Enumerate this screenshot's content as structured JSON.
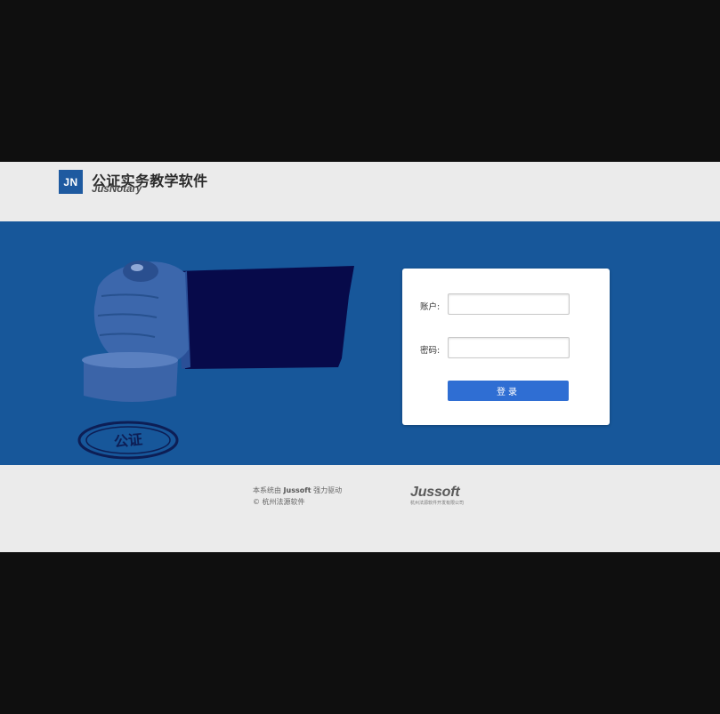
{
  "header": {
    "logo_mark": "JN",
    "title": "公证实务教学软件",
    "subtitle": "JusNotary"
  },
  "banner": {
    "stamp_text": "公证"
  },
  "login": {
    "account_label": "账户:",
    "account_value": "",
    "password_label": "密码:",
    "password_value": "",
    "submit_label": "登录"
  },
  "footer": {
    "powered_prefix": "本系统由",
    "powered_brand": "Jussoft",
    "powered_suffix": "强力驱动",
    "copyright": "© 杭州法源软件",
    "brand_logo": "Jussoft",
    "brand_company": "杭州法源软件开发有限公司"
  },
  "colors": {
    "banner_bg": "#17579a",
    "logo_bg": "#1e5aa0",
    "button_bg": "#2f6ed3",
    "header_bg": "#ebebeb",
    "letterbox": "#0f0f0f"
  }
}
